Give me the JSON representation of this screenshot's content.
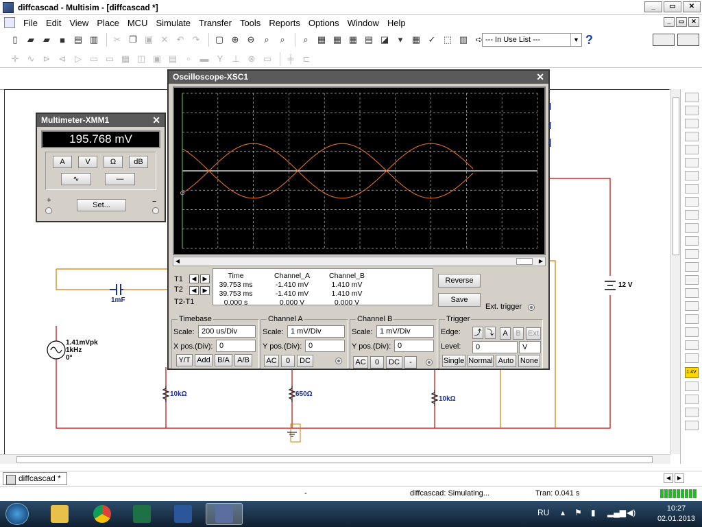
{
  "window": {
    "title": "diffcascad - Multisim - [diffcascad *]"
  },
  "menu": [
    "File",
    "Edit",
    "View",
    "Place",
    "MCU",
    "Simulate",
    "Transfer",
    "Tools",
    "Reports",
    "Options",
    "Window",
    "Help"
  ],
  "toolbar": {
    "in_use_list": "--- In Use List ---",
    "help": "?"
  },
  "circuit": {
    "capacitor": "1mF",
    "source": [
      "1.41mVpk",
      "1kHz",
      "0°"
    ],
    "r_left": "10kΩ",
    "r_mid": "650Ω",
    "r_right": "10kΩ",
    "battery": "12 V"
  },
  "multimeter": {
    "title": "Multimeter-XMM1",
    "reading": "195.768 mV",
    "buttons": [
      "A",
      "V",
      "Ω",
      "dB"
    ],
    "set_label": "Set...",
    "plus": "+",
    "minus": "−"
  },
  "oscilloscope": {
    "title": "Oscilloscope-XSC1",
    "cursors": {
      "t1_label": "T1",
      "t2_label": "T2",
      "diff_label": "T2-T1",
      "headers": [
        "Time",
        "Channel_A",
        "Channel_B"
      ],
      "t1": [
        "39.753 ms",
        "-1.410 mV",
        "1.410 mV"
      ],
      "t2": [
        "39.753 ms",
        "-1.410 mV",
        "1.410 mV"
      ],
      "diff": [
        "0.000 s",
        "0.000 V",
        "0.000 V"
      ]
    },
    "reverse_label": "Reverse",
    "save_label": "Save",
    "ext_trigger_label": "Ext. trigger",
    "timebase": {
      "label": "Timebase",
      "scale_label": "Scale:",
      "scale": "200 us/Div",
      "xpos_label": "X pos.(Div):",
      "xpos": "0",
      "buttons": [
        "Y/T",
        "Add",
        "B/A",
        "A/B"
      ]
    },
    "channel_a": {
      "label": "Channel A",
      "scale_label": "Scale:",
      "scale": "1 mV/Div",
      "ypos_label": "Y pos.(Div):",
      "ypos": "0",
      "buttons": [
        "AC",
        "0",
        "DC"
      ]
    },
    "channel_b": {
      "label": "Channel B",
      "scale_label": "Scale:",
      "scale": "1 mV/Div",
      "ypos_label": "Y pos.(Div):",
      "ypos": "0",
      "buttons": [
        "AC",
        "0",
        "DC",
        "-"
      ]
    },
    "trigger": {
      "label": "Trigger",
      "edge_label": "Edge:",
      "level_label": "Level:",
      "level": "0",
      "level_unit": "V",
      "edge_buttons": [
        "A",
        "B",
        "Ext"
      ],
      "mode_buttons": [
        "Single",
        "Normal",
        "Auto",
        "None"
      ]
    },
    "trace_color": "#e07020"
  },
  "tab": {
    "label": "diffcascad *"
  },
  "status": {
    "dash": "-",
    "simulating": "diffcascad: Simulating...",
    "tran": "Tran: 0.041 s"
  },
  "taskbar": {
    "lang": "RU",
    "time": "10:27",
    "date": "02.01.2013"
  }
}
